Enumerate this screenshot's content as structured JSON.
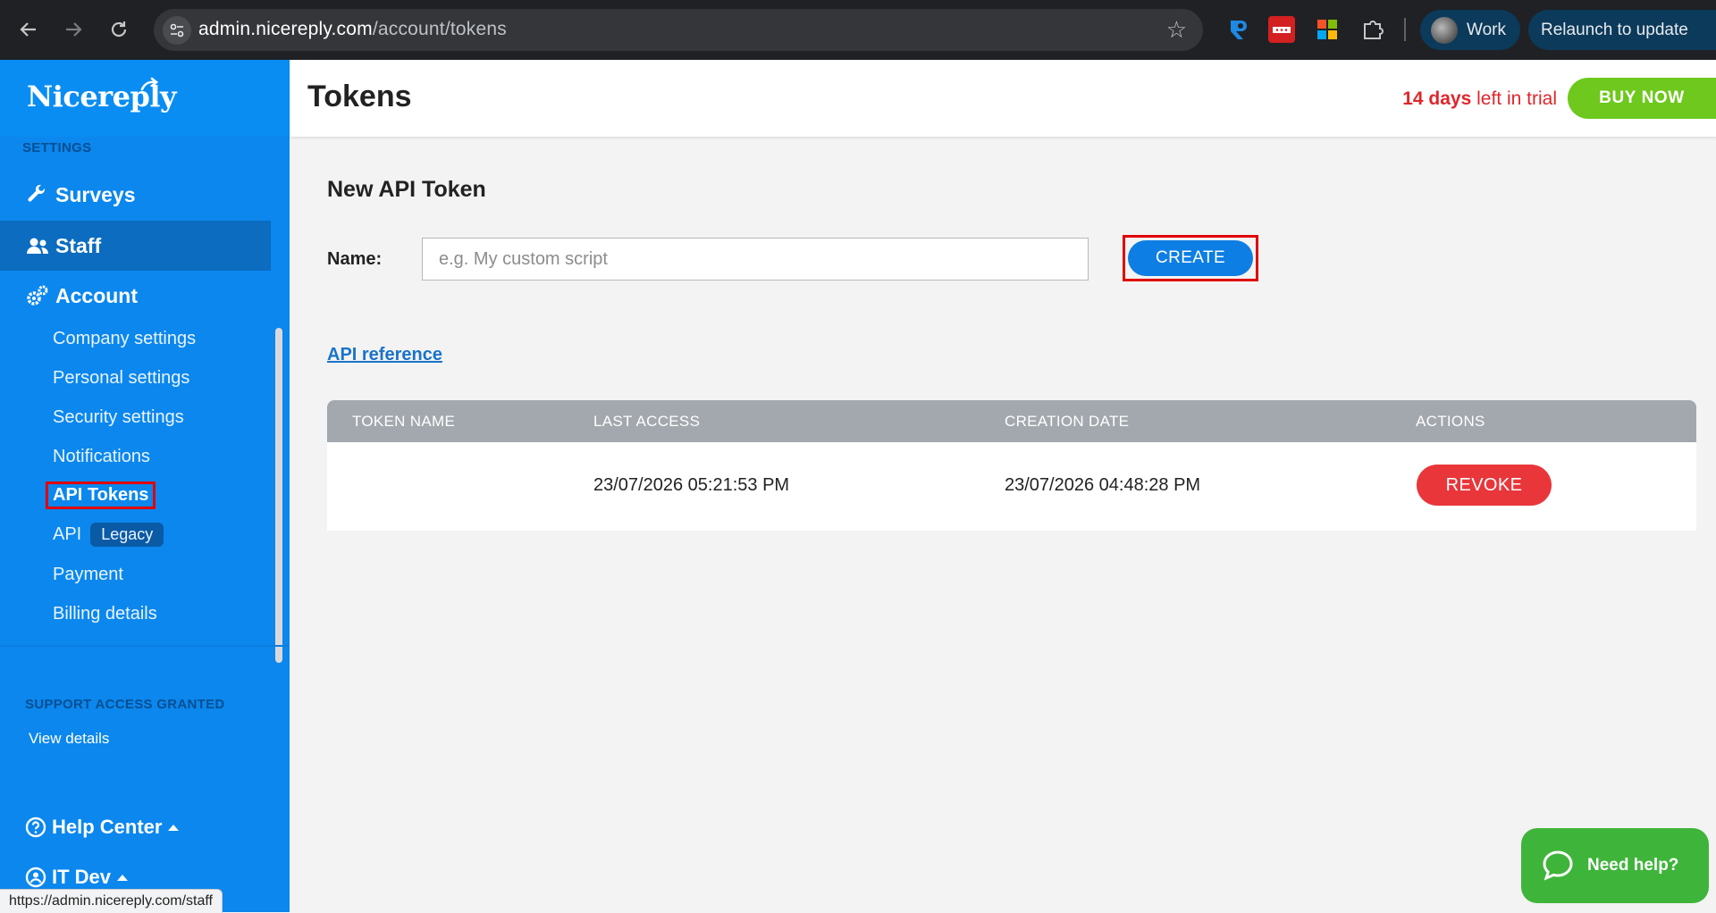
{
  "browser": {
    "url_host": "admin.nicereply.com",
    "url_path": "/account/tokens",
    "profile_label": "Work",
    "relaunch_label": "Relaunch to update",
    "status_url": "https://admin.nicereply.com/staff"
  },
  "sidebar": {
    "logo": "Nicereply",
    "settings_label": "SETTINGS",
    "main_items": [
      {
        "label": "Surveys",
        "icon": "wrench-icon"
      },
      {
        "label": "Staff",
        "icon": "users-icon"
      },
      {
        "label": "Account",
        "icon": "gears-icon"
      }
    ],
    "account_items": [
      {
        "label": "Company settings"
      },
      {
        "label": "Personal settings"
      },
      {
        "label": "Security settings"
      },
      {
        "label": "Notifications"
      },
      {
        "label": "API Tokens"
      },
      {
        "label": "API",
        "badge": "Legacy"
      },
      {
        "label": "Payment"
      },
      {
        "label": "Billing details"
      }
    ],
    "support_label": "SUPPORT ACCESS GRANTED",
    "view_details": "View details",
    "help_center": "Help Center",
    "user": "IT Dev"
  },
  "header": {
    "title": "Tokens",
    "trial_days": "14 days",
    "trial_rest": " left in trial",
    "buy_now": "BUY NOW"
  },
  "main": {
    "section_title": "New API Token",
    "name_label": "Name:",
    "name_placeholder": "e.g. My custom script",
    "name_value": "",
    "create_label": "CREATE",
    "api_reference": "API reference",
    "table": {
      "columns": [
        "TOKEN NAME",
        "LAST ACCESS",
        "CREATION DATE",
        "ACTIONS"
      ],
      "rows": [
        {
          "token_name": "",
          "last_access": "23/07/2026 05:21:53 PM",
          "creation_date": "23/07/2026 04:48:28 PM",
          "action": "REVOKE"
        }
      ]
    }
  },
  "help_widget": {
    "label": "Need help?"
  },
  "colors": {
    "sidebar": "#0b87ee",
    "primary_button": "#0d7ee3",
    "buy_now": "#6ec81d",
    "revoke": "#e8363b",
    "trial_text": "#e0262c",
    "highlight_box": "#e00000"
  }
}
